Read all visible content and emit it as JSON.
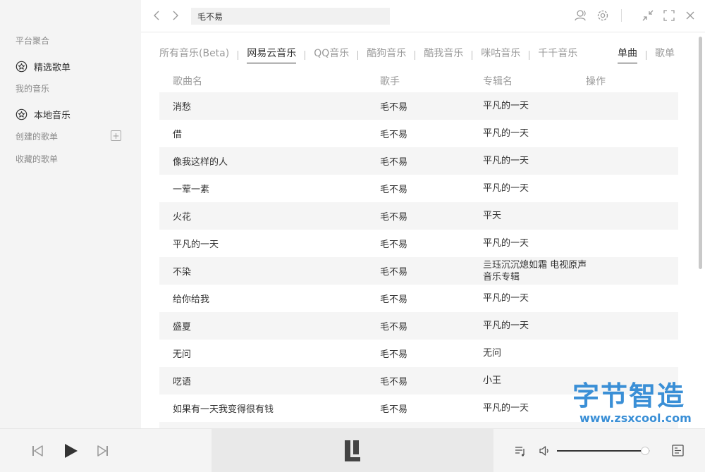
{
  "sidebar": {
    "section_platform": "平台聚合",
    "featured": "精选歌单",
    "section_my_music": "我的音乐",
    "local": "本地音乐",
    "section_created": "创建的歌单",
    "section_collected": "收藏的歌单"
  },
  "topbar": {
    "search_value": "毛不易"
  },
  "source_tabs": [
    "所有音乐(Beta)",
    "网易云音乐",
    "QQ音乐",
    "酷狗音乐",
    "酷我音乐",
    "咪咕音乐",
    "千千音乐"
  ],
  "active_source": 1,
  "type_tabs": [
    "单曲",
    "歌单"
  ],
  "active_type": 0,
  "columns": {
    "name": "歌曲名",
    "artist": "歌手",
    "album": "专辑名",
    "actions": "操作"
  },
  "songs": [
    {
      "name": "消愁",
      "artist": "毛不易",
      "album": "平凡的一天"
    },
    {
      "name": "借",
      "artist": "毛不易",
      "album": "平凡的一天"
    },
    {
      "name": "像我这样的人",
      "artist": "毛不易",
      "album": "平凡的一天"
    },
    {
      "name": "一荤一素",
      "artist": "毛不易",
      "album": "平凡的一天"
    },
    {
      "name": "火花",
      "artist": "毛不易",
      "album": "平天"
    },
    {
      "name": "平凡的一天",
      "artist": "毛不易",
      "album": "平凡的一天"
    },
    {
      "name": "不染",
      "artist": "毛不易",
      "album": "亖珏沉沉熄如霜 电视原声音乐专辑"
    },
    {
      "name": "给你给我",
      "artist": "毛不易",
      "album": "平凡的一天"
    },
    {
      "name": "盛夏",
      "artist": "毛不易",
      "album": "平凡的一天"
    },
    {
      "name": "无问",
      "artist": "毛不易",
      "album": "无问"
    },
    {
      "name": "呓语",
      "artist": "毛不易",
      "album": "小王"
    },
    {
      "name": "如果有一天我变得很有钱",
      "artist": "毛不易",
      "album": "平凡的一天"
    }
  ],
  "player": {
    "volume": 0.95
  },
  "watermark": {
    "line1": "字节智造",
    "line2": "www.zsxcool.com"
  },
  "colors": {
    "accent": "#333333",
    "muted": "#9a9a9a",
    "watermark": "#3a8fd6"
  },
  "icons": {
    "back": "chevron-left-icon",
    "forward": "chevron-right-icon",
    "user": "user-icon",
    "settings": "gear-icon",
    "minimize": "compress-icon",
    "maximize": "expand-icon",
    "close": "close-icon",
    "prev": "skip-previous-icon",
    "play": "play-icon",
    "next": "skip-next-icon",
    "playlist": "playlist-icon",
    "volume": "volume-icon",
    "lyrics": "lyrics-icon",
    "logo": "app-logo-icon"
  }
}
